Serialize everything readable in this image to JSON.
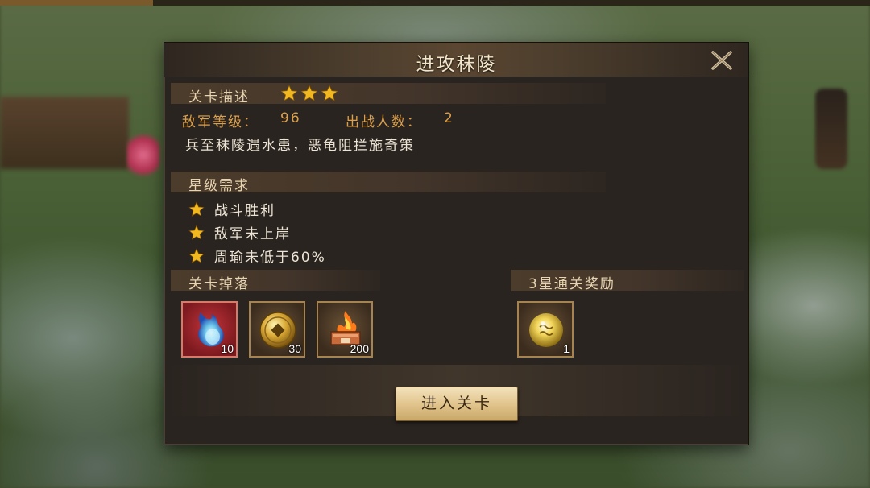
{
  "dialog": {
    "title": "进攻秣陵",
    "description_section": {
      "label": "关卡描述",
      "stars_earned": 3,
      "enemy_level_label": "敌军等级：",
      "enemy_level_value": "96",
      "troops_label": "出战人数：",
      "troops_value": "2",
      "story_text": "兵至秣陵遇水患，恶龟阻拦施奇策"
    },
    "star_requirements": {
      "label": "星级需求",
      "items": [
        "战斗胜利",
        "敌军未上岸",
        "周瑜未低于60%"
      ]
    },
    "drops": {
      "label": "关卡掉落",
      "items": [
        {
          "icon": "blue-soul-flame-icon",
          "count": "10"
        },
        {
          "icon": "gold-coin-icon",
          "count": "30"
        },
        {
          "icon": "fire-chest-icon",
          "count": "200"
        }
      ]
    },
    "three_star_reward": {
      "label": "3星通关奖励",
      "items": [
        {
          "icon": "gold-orb-icon",
          "count": "1"
        }
      ]
    },
    "enter_button_label": "进入关卡"
  },
  "colors": {
    "accent_orange": "#dda04a",
    "star_gold": "#f2b81f",
    "button_gold": "#e2c58e"
  }
}
